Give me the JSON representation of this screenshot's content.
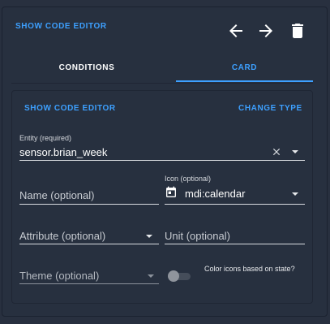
{
  "header": {
    "show_code_editor": "SHOW CODE EDITOR",
    "icons": [
      "arrow-left-icon",
      "arrow-right-icon",
      "trash-icon"
    ]
  },
  "tabs": [
    {
      "label": "CONDITIONS",
      "active": false
    },
    {
      "label": "CARD",
      "active": true
    }
  ],
  "card": {
    "show_code_editor": "SHOW CODE EDITOR",
    "change_type": "CHANGE TYPE",
    "entity": {
      "label": "Entity (required)",
      "value": "sensor.brian_week"
    },
    "name": {
      "placeholder": "Name (optional)"
    },
    "icon": {
      "label": "Icon (optional)",
      "value": "mdi:calendar",
      "icon": "calendar-icon"
    },
    "attribute": {
      "placeholder": "Attribute (optional)"
    },
    "unit": {
      "placeholder": "Unit (optional)"
    },
    "theme": {
      "placeholder": "Theme (optional)"
    },
    "color_icons": {
      "label": "Color icons based on state?",
      "checked": false
    }
  },
  "colors": {
    "background": "#28303f",
    "accent": "#3da0ff",
    "text": "#ffffff"
  }
}
